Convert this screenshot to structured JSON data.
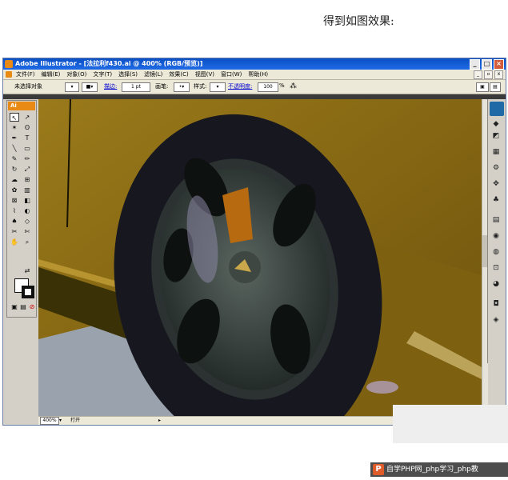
{
  "caption": "得到如图效果:",
  "window": {
    "title": "Adobe Illustrator - [法拉利f430.ai @ 400% (RGB/预览)]",
    "controls": [
      "_",
      "□",
      "×"
    ]
  },
  "menu": {
    "items": [
      "文件(F)",
      "编辑(E)",
      "对象(O)",
      "文字(T)",
      "选择(S)",
      "滤镜(L)",
      "效果(C)",
      "视图(V)",
      "窗口(W)",
      "帮助(H)"
    ]
  },
  "control_bar": {
    "selection": "未选择对象",
    "stroke_label": "描边:",
    "stroke_weight": "1 pt",
    "brush_label": "画笔:",
    "style_label": "样式:",
    "opacity_label": "不透明度:",
    "opacity_value": "100",
    "opacity_unit": "%"
  },
  "toolbox": {
    "header": "Ai",
    "tools": [
      "selection-tool",
      "direct-selection-tool",
      "magic-wand-tool",
      "lasso-tool",
      "pen-tool",
      "type-tool",
      "line-tool",
      "rectangle-tool",
      "paintbrush-tool",
      "pencil-tool",
      "rotate-tool",
      "scale-tool",
      "warp-tool",
      "free-transform-tool",
      "symbol-sprayer-tool",
      "column-graph-tool",
      "mesh-tool",
      "gradient-tool",
      "eyedropper-tool",
      "blend-tool",
      "live-paint-bucket-tool",
      "live-paint-selection-tool",
      "slice-tool",
      "scissors-tool",
      "hand-tool",
      "zoom-tool"
    ]
  },
  "status_bar": {
    "zoom": "400%",
    "status_text": "打开"
  },
  "colors": {
    "car_body": "#8a6a12",
    "tire": "#17171f",
    "rim": "#3e4844",
    "ground": "#9aa3ad"
  },
  "watermark": {
    "text": "自学PHP网_php学习_php教"
  }
}
